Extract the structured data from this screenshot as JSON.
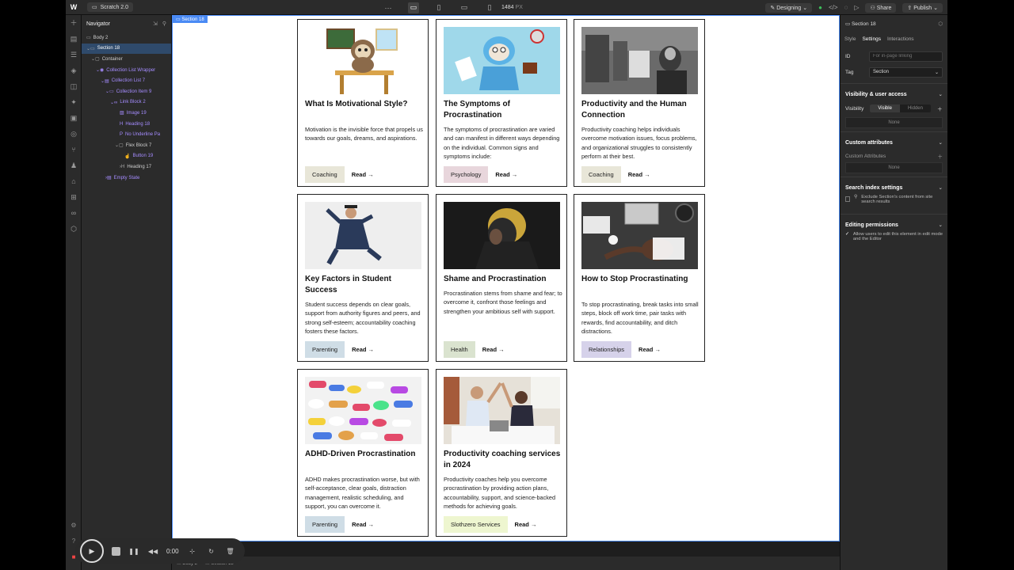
{
  "topbar": {
    "logo": "W",
    "project": "Scratch 2.0",
    "dots": "···",
    "width": "1484",
    "width_unit": "PX",
    "mode": "Designing",
    "share": "Share",
    "publish": "Publish"
  },
  "navigator": {
    "title": "Navigator",
    "items": [
      {
        "label": "Body 2"
      },
      {
        "label": "Section 18"
      },
      {
        "label": "Container"
      },
      {
        "label": "Collection List Wrapper"
      },
      {
        "label": "Collection List 7"
      },
      {
        "label": "Collection Item 9"
      },
      {
        "label": "Link Block 2"
      },
      {
        "label": "Image 19"
      },
      {
        "label": "Heading 18"
      },
      {
        "label": "No Underline Pa"
      },
      {
        "label": "Flex Block 7"
      },
      {
        "label": "Button 19"
      },
      {
        "label": "Heading 17"
      },
      {
        "label": "Empty State"
      }
    ]
  },
  "canvas": {
    "selection_label": "Section 18",
    "cards": [
      {
        "title": "What Is Motivational Style?",
        "text": "Motivation is the invisible force that propels us towards our goals, dreams, and aspirations.",
        "tag": "Coaching",
        "tag_color": "#e8e6d8",
        "read": "Read →",
        "image": "sloth-teacher"
      },
      {
        "title": "The Symptoms of Procrastination",
        "text": "The symptoms of procrastination are varied and can manifest in different ways depending on the individual. Common signs and symptoms include:",
        "tag": "Psychology",
        "tag_color": "#e8d6dc",
        "read": "Read →",
        "image": "sloth-running"
      },
      {
        "title": "Productivity and the Human Connection",
        "text": "Productivity coaching helps individuals overcome motivation issues, focus problems, and organizational struggles to consistently perform at their best.",
        "tag": "Coaching",
        "tag_color": "#e8e6d8",
        "read": "Read →",
        "image": "street-photo"
      },
      {
        "title": "Key Factors in Student Success",
        "text": "Student success depends on clear goals, support from authority figures and peers, and strong self-esteem; accountability coaching fosters these factors.",
        "tag": "Parenting",
        "tag_color": "#cfdde6",
        "read": "Read →",
        "image": "graduate-jump"
      },
      {
        "title": "Shame and Procrastination",
        "text": "Procrastination stems from shame and fear; to overcome it, confront those feelings and strengthen your ambitious self with support.",
        "tag": "Health",
        "tag_color": "#dae3cf",
        "read": "Read →",
        "image": "hooded-man"
      },
      {
        "title": "How to Stop Procrastinating",
        "text": "To stop procrastinating, break tasks into small steps, block off work time, pair tasks with rewards, find accountability, and ditch distractions.",
        "tag": "Relationships",
        "tag_color": "#d6d2ea",
        "read": "Read →",
        "image": "desk-overhead"
      },
      {
        "title": "ADHD-Driven Procrastination",
        "text": "ADHD makes procrastination worse, but with self-acceptance, clear goals, distraction management, realistic scheduling, and support, you can overcome it.",
        "tag": "Parenting",
        "tag_color": "#cfdde6",
        "read": "Read →",
        "image": "pills"
      },
      {
        "title": "Productivity coaching services in 2024",
        "text": "Productivity coaches help you overcome procrastination by providing action plans, accountability, support, and science-backed methods for achieving goals.",
        "tag": "Slothzero Services",
        "tag_color": "#eef6d0",
        "read": "Read →",
        "image": "office-highfive"
      }
    ]
  },
  "bottombar": {
    "crumb1": "Body 2",
    "crumb2": "Section 18"
  },
  "right_panel": {
    "element": "Section 18",
    "tabs": [
      "Style",
      "Settings",
      "Interactions"
    ],
    "id_label": "ID",
    "id_placeholder": "For in-page linking",
    "tag_label": "Tag",
    "tag_value": "Section",
    "visibility_title": "Visibility & user access",
    "visibility_label": "Visibility",
    "visible": "Visible",
    "hidden": "Hidden",
    "none1": "None",
    "custom_attr_title": "Custom attributes",
    "custom_attr_label": "Custom Attributes",
    "none2": "None",
    "search_title": "Search index settings",
    "search_text": "Exclude Section's content from site search results",
    "edit_title": "Editing permissions",
    "edit_text": "Allow users to edit this element in edit mode and the Editor"
  },
  "recorder": {
    "time": "0:00"
  }
}
